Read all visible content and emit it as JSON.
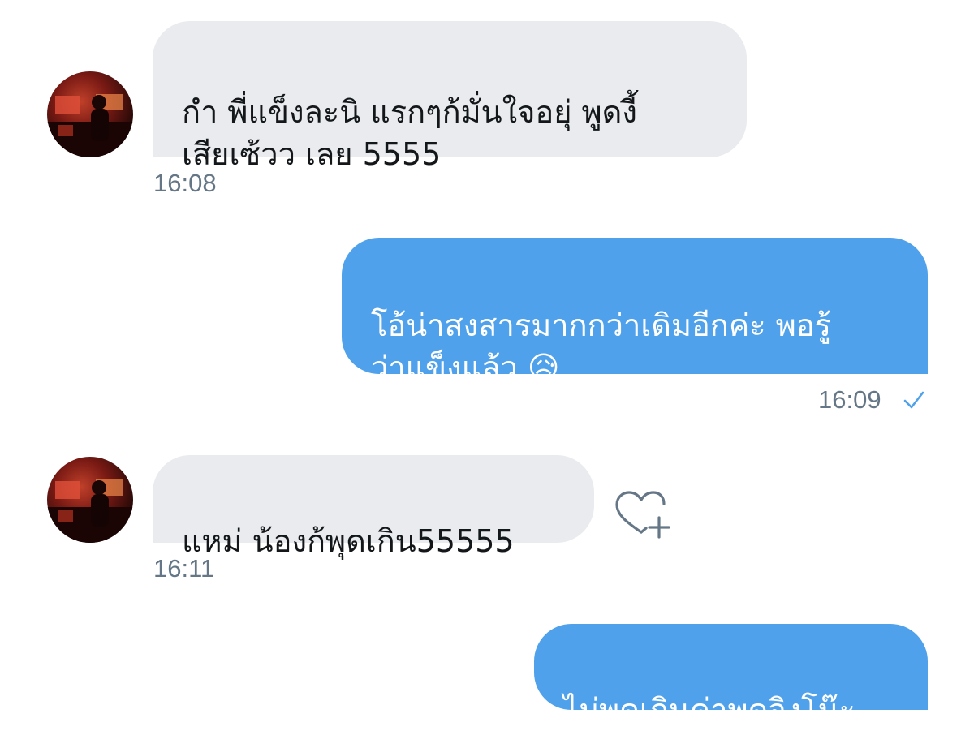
{
  "messages": [
    {
      "direction": "in",
      "text": "กำ พี่แข็งละนิ  แรกๆก้มั่นใจอยุ่ พูดงี้\nเสียเซ้วว เลย 5555",
      "time": "16:08"
    },
    {
      "direction": "out",
      "text": "โอ้น่าสงสารมากกว่าเดิมอีกค่ะ พอรู้\nว่าแข็งแล้ว 😥",
      "time": "16:09",
      "status_icon": "check-icon"
    },
    {
      "direction": "in",
      "text": "แหม่ น้องก้พุดเกิน55555",
      "time": "16:11",
      "reaction_icon": "heart-plus-icon"
    },
    {
      "direction": "out",
      "text": "ไม่พูดเกินค่าพูดจิงโน๊ะ"
    }
  ],
  "colors": {
    "incoming_bubble": "#e9ebef",
    "outgoing_bubble": "#4ea1ea",
    "timestamp": "#657786",
    "check": "#4ea1ea"
  }
}
